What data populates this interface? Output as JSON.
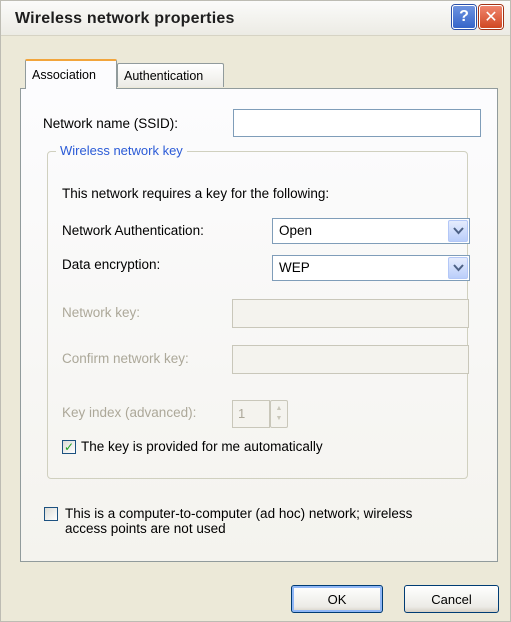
{
  "window": {
    "title": "Wireless network properties"
  },
  "titlebar_buttons": {
    "help": "?",
    "close": "✕"
  },
  "tabs": [
    {
      "label": "Association",
      "active": true
    },
    {
      "label": "Authentication",
      "active": false
    }
  ],
  "association": {
    "ssid_label": "Network name (SSID):",
    "ssid_value": "",
    "group_title": "Wireless network key",
    "key_required_text": "This network requires a key for the following:",
    "net_auth_label": "Network Authentication:",
    "net_auth_value": "Open",
    "data_enc_label": "Data encryption:",
    "data_enc_value": "WEP",
    "network_key_label": "Network key:",
    "network_key_value": "",
    "confirm_key_label": "Confirm network key:",
    "confirm_key_value": "",
    "key_index_label": "Key index (advanced):",
    "key_index_value": "1",
    "auto_key_label": "The key is provided for me automatically",
    "auto_key_checked": true,
    "adhoc_label_line1": "This is a computer-to-computer (ad hoc) network; wireless",
    "adhoc_label_line2": "access points are not used",
    "adhoc_checked": false
  },
  "buttons": {
    "ok": "OK",
    "cancel": "Cancel"
  },
  "icons": {
    "dropdown": "chevron-down-icon",
    "checkmark": "checkmark-icon",
    "spinner_up": "spinner-up-icon",
    "spinner_down": "spinner-down-icon"
  },
  "colors": {
    "title_close": "#d04722",
    "title_help": "#3564c9",
    "group_legend": "#2b5bd7",
    "active_tab_accent": "#f2a53c"
  }
}
